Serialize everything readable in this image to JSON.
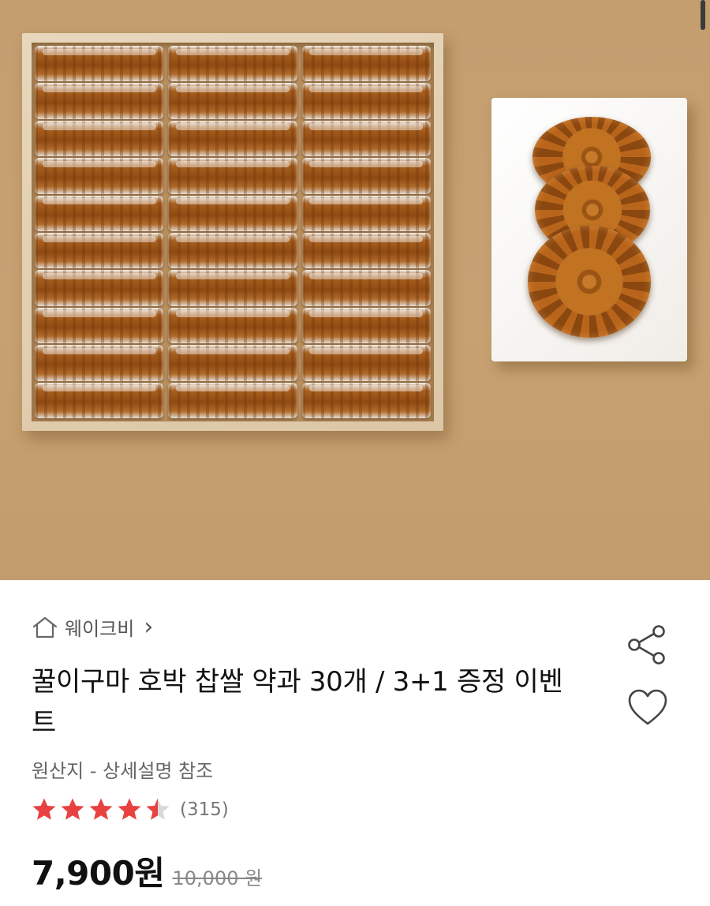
{
  "store": {
    "name": "웨이크비",
    "chevron": "›"
  },
  "product": {
    "title": "꿀이구마 호박 찹쌀 약과 30개 / 3+1 증정 이벤트",
    "origin": "원산지 - 상세설명 참조",
    "rating": {
      "value": 4.5,
      "max": 5,
      "review_count": "(315)",
      "star_color": "#e8413f",
      "empty_color": "#d8d8d8"
    },
    "price": "7,900원",
    "original_price": "10,000 원"
  },
  "icons": {
    "home": "home-icon",
    "share": "share-icon",
    "heart": "heart-icon",
    "star": "star-icon"
  },
  "colors": {
    "background_photo": "#c49e6f",
    "text_primary": "#111111",
    "text_secondary": "#666666"
  }
}
